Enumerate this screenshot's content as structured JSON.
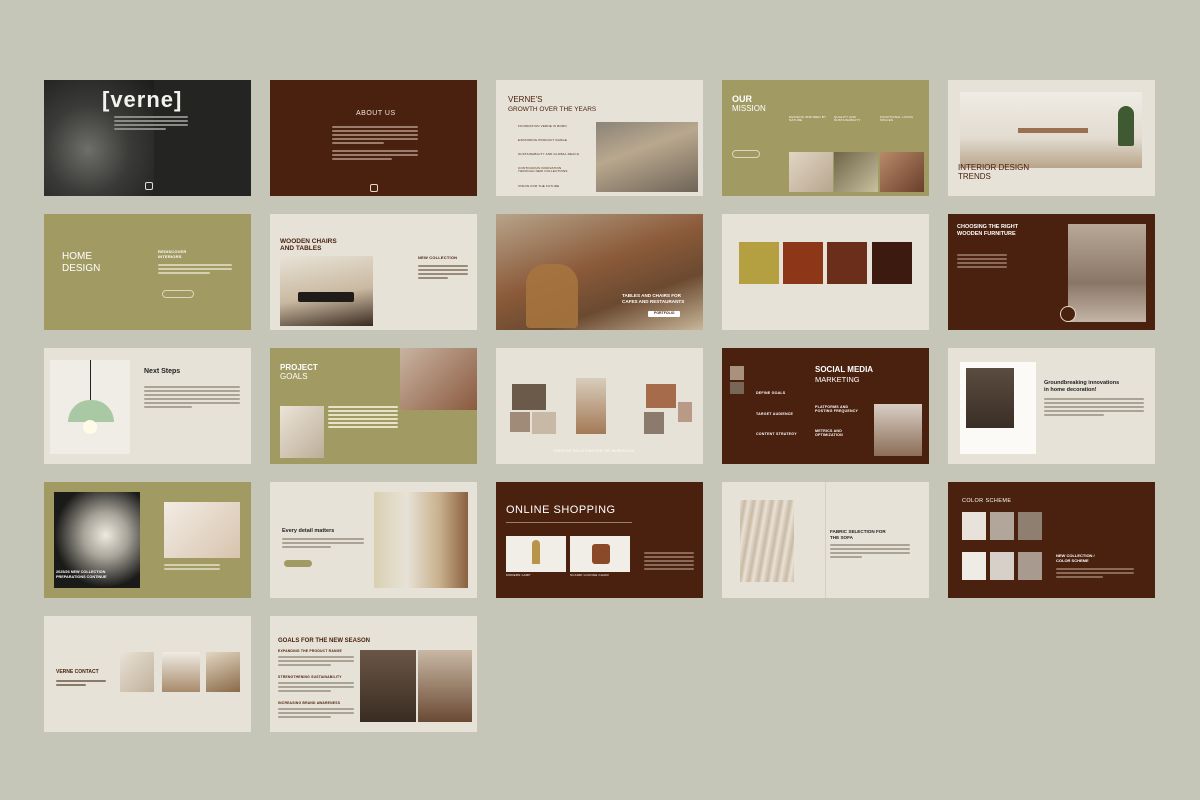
{
  "slides": {
    "s1": {
      "brand": "[verne]"
    },
    "s2": {
      "title": "ABOUT US"
    },
    "s3": {
      "title1": "VERNE'S",
      "title2": "GROWTH OVER THE YEARS",
      "items": [
        "FOUNDATION VERNE IS BORN",
        "EXPANDING PRODUCT RANGE",
        "SUSTAINABILITY AND GLOBAL REACH",
        "CONTINUOUS INNOVATION THROUGH NEW COLLECTIONS",
        "VISION FOR THE FUTURE"
      ]
    },
    "s4": {
      "title1": "OUR",
      "title2": "MISSION",
      "cols": [
        "DESIGNS INSPIRED BY NATURE",
        "QUALITY AND SUSTAINABILITY",
        "FUNCTIONAL LIVING SPACES"
      ]
    },
    "s5": {
      "title1": "INTERIOR DESIGN",
      "title2": "TRENDS"
    },
    "s6": {
      "title1": "HOME",
      "title2": "DESIGN",
      "sub1": "REDISCOVER",
      "sub2": "INTERIORS"
    },
    "s7": {
      "title1": "WOODEN CHAIRS",
      "title2": "AND TABLES",
      "sub": "NEW COLLECTION"
    },
    "s8": {
      "line1": "TABLES AND CHAIRS FOR",
      "line2": "CAFES AND RESTAURANTS",
      "button": "PORTFOLIO"
    },
    "s9": {
      "colors": [
        "#b4a040",
        "#8e3718",
        "#6b2e1a",
        "#3d1a0f"
      ]
    },
    "s10": {
      "title1": "CHOOSING THE RIGHT",
      "title2": "WOODEN FURNITURE"
    },
    "s11": {
      "title": "Next Steps"
    },
    "s12": {
      "title1": "PROJECT",
      "title2": "GOALS"
    },
    "s13": {
      "caption": "CREATIVE SOLUTIONS FOR THE WORKPLACE"
    },
    "s14": {
      "title1": "SOCIAL MEDIA",
      "title2": "MARKETING",
      "left": [
        "DEFINE GOALS",
        "TARGET AUDIENCE",
        "CONTENT STRATEGY"
      ],
      "right": [
        "PLATFORMS AND POSTING FREQUENCY",
        "METRICS AND OPTIMIZATION"
      ]
    },
    "s15": {
      "title1": "Groundbreaking innovations",
      "title2": "in home decoration!"
    },
    "s16": {
      "title1": "2025/26 NEW COLLECTION",
      "title2": "PREPARATIONS CONTINUE"
    },
    "s17": {
      "title": "Every detail matters"
    },
    "s18": {
      "title": "ONLINE SHOPPING",
      "label1": "MODERN LAMP",
      "label2": "SCANDI LOUNGE CHAIR"
    },
    "s19": {
      "title1": "FABRIC SELECTION FOR",
      "title2": "THE SOFA"
    },
    "s20": {
      "title": "COLOR SCHEME",
      "sub1": "NEW COLLECTION /",
      "sub2": "COLOR SCHEME",
      "swatches": [
        "#e8e2da",
        "#b2a69a",
        "#8f7f71",
        "#efece6",
        "#d6d0c9",
        "#a89a8f"
      ]
    },
    "s21": {
      "title": "VERNE CONTACT"
    },
    "s22": {
      "title": "GOALS FOR THE NEW SEASON",
      "items": [
        "EXPANDING THE PRODUCT RANGE",
        "STRENGTHENING SUSTAINABILITY",
        "INCREASING BRAND AWARENESS"
      ]
    }
  }
}
